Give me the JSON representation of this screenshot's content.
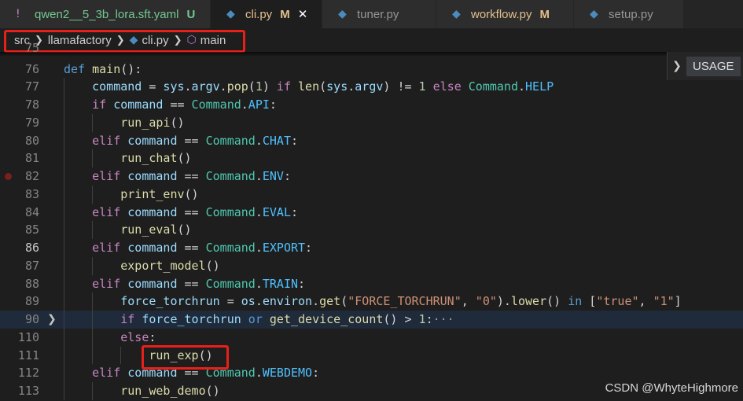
{
  "tabs": [
    {
      "label": "qwen2__5_3b_lora.sft.yaml",
      "status": "U",
      "icon": "exclamation-icon",
      "icon_glyph": "!",
      "icon_color": "#c586c0",
      "label_color": "#73c991",
      "active": false,
      "width": 268
    },
    {
      "label": "cli.py",
      "status": "M",
      "icon": "python-icon",
      "icon_glyph": "◆",
      "icon_color": "#4b8bbe",
      "label_color": "#e2c08d",
      "active": true,
      "close": "✕",
      "width": 142
    },
    {
      "label": "tuner.py",
      "icon": "python-icon",
      "icon_glyph": "◆",
      "icon_color": "#4b8bbe",
      "label_color": "#969696",
      "active": false,
      "width": 145
    },
    {
      "label": "workflow.py",
      "status": "M",
      "icon": "python-icon",
      "icon_glyph": "◆",
      "icon_color": "#4b8bbe",
      "label_color": "#e2c08d",
      "active": false,
      "width": 175
    },
    {
      "label": "setup.py",
      "icon": "python-icon",
      "icon_glyph": "◆",
      "icon_color": "#4b8bbe",
      "label_color": "#969696",
      "active": false,
      "width": 140
    }
  ],
  "breadcrumb": {
    "src": "src",
    "pkg": "llamafactory",
    "file": "cli.py",
    "symbol": "main"
  },
  "usage_label": "USAGE",
  "watermark": "CSDN @WhyteHighmore",
  "lines": [
    {
      "n": "76",
      "indent": 0,
      "tokens": [
        [
          "k",
          "def "
        ],
        [
          "f",
          "main"
        ],
        [
          "p",
          "():"
        ]
      ]
    },
    {
      "n": "77",
      "indent": 1,
      "tokens": [
        [
          "v",
          "command"
        ],
        [
          "p",
          " = "
        ],
        [
          "v",
          "sys"
        ],
        [
          "p",
          "."
        ],
        [
          "v",
          "argv"
        ],
        [
          "p",
          "."
        ],
        [
          "f",
          "pop"
        ],
        [
          "p",
          "("
        ],
        [
          "n",
          "1"
        ],
        [
          "p",
          ") "
        ],
        [
          "kc",
          "if "
        ],
        [
          "f",
          "len"
        ],
        [
          "p",
          "("
        ],
        [
          "v",
          "sys"
        ],
        [
          "p",
          "."
        ],
        [
          "v",
          "argv"
        ],
        [
          "p",
          ") != "
        ],
        [
          "n",
          "1"
        ],
        [
          "p",
          " "
        ],
        [
          "kc",
          "else "
        ],
        [
          "c",
          "Command"
        ],
        [
          "p",
          "."
        ],
        [
          "e",
          "HELP"
        ]
      ]
    },
    {
      "n": "78",
      "indent": 1,
      "tokens": [
        [
          "kc",
          "if "
        ],
        [
          "v",
          "command"
        ],
        [
          "p",
          " == "
        ],
        [
          "c",
          "Command"
        ],
        [
          "p",
          "."
        ],
        [
          "e",
          "API"
        ],
        [
          "p",
          ":"
        ]
      ]
    },
    {
      "n": "79",
      "indent": 2,
      "tokens": [
        [
          "f",
          "run_api"
        ],
        [
          "p",
          "()"
        ]
      ]
    },
    {
      "n": "80",
      "indent": 1,
      "tokens": [
        [
          "kc",
          "elif "
        ],
        [
          "v",
          "command"
        ],
        [
          "p",
          " == "
        ],
        [
          "c",
          "Command"
        ],
        [
          "p",
          "."
        ],
        [
          "e",
          "CHAT"
        ],
        [
          "p",
          ":"
        ]
      ]
    },
    {
      "n": "81",
      "indent": 2,
      "tokens": [
        [
          "f",
          "run_chat"
        ],
        [
          "p",
          "()"
        ]
      ]
    },
    {
      "n": "82",
      "indent": 1,
      "breakpoint": true,
      "tokens": [
        [
          "kc",
          "elif "
        ],
        [
          "v",
          "command"
        ],
        [
          "p",
          " == "
        ],
        [
          "c",
          "Command"
        ],
        [
          "p",
          "."
        ],
        [
          "e",
          "ENV"
        ],
        [
          "p",
          ":"
        ]
      ]
    },
    {
      "n": "83",
      "indent": 2,
      "tokens": [
        [
          "f",
          "print_env"
        ],
        [
          "p",
          "()"
        ]
      ]
    },
    {
      "n": "84",
      "indent": 1,
      "tokens": [
        [
          "kc",
          "elif "
        ],
        [
          "v",
          "command"
        ],
        [
          "p",
          " == "
        ],
        [
          "c",
          "Command"
        ],
        [
          "p",
          "."
        ],
        [
          "e",
          "EVAL"
        ],
        [
          "p",
          ":"
        ]
      ]
    },
    {
      "n": "85",
      "indent": 2,
      "tokens": [
        [
          "f",
          "run_eval"
        ],
        [
          "p",
          "()"
        ]
      ]
    },
    {
      "n": "86",
      "indent": 1,
      "current": true,
      "tokens": [
        [
          "kc",
          "elif "
        ],
        [
          "v",
          "command"
        ],
        [
          "p",
          " == "
        ],
        [
          "c",
          "Command"
        ],
        [
          "p",
          "."
        ],
        [
          "e",
          "EXPORT"
        ],
        [
          "p",
          ":"
        ]
      ]
    },
    {
      "n": "87",
      "indent": 2,
      "tokens": [
        [
          "f",
          "export_model"
        ],
        [
          "p",
          "()"
        ]
      ]
    },
    {
      "n": "88",
      "indent": 1,
      "tokens": [
        [
          "kc",
          "elif "
        ],
        [
          "v",
          "command"
        ],
        [
          "p",
          " == "
        ],
        [
          "c",
          "Command"
        ],
        [
          "p",
          "."
        ],
        [
          "e",
          "TRAIN"
        ],
        [
          "p",
          ":"
        ]
      ]
    },
    {
      "n": "89",
      "indent": 2,
      "tokens": [
        [
          "v",
          "force_torchrun"
        ],
        [
          "p",
          " = "
        ],
        [
          "v",
          "os"
        ],
        [
          "p",
          "."
        ],
        [
          "v",
          "environ"
        ],
        [
          "p",
          "."
        ],
        [
          "f",
          "get"
        ],
        [
          "p",
          "("
        ],
        [
          "s",
          "\"FORCE_TORCHRUN\""
        ],
        [
          "p",
          ", "
        ],
        [
          "s",
          "\"0\""
        ],
        [
          "p",
          ")."
        ],
        [
          "f",
          "lower"
        ],
        [
          "p",
          "() "
        ],
        [
          "k",
          "in "
        ],
        [
          "p",
          "["
        ],
        [
          "s",
          "\"true\""
        ],
        [
          "p",
          ", "
        ],
        [
          "s",
          "\"1\""
        ],
        [
          "p",
          "]"
        ]
      ]
    },
    {
      "n": "90",
      "indent": 2,
      "fold": true,
      "highlight": true,
      "tokens": [
        [
          "kc",
          "if "
        ],
        [
          "v",
          "force_torchrun"
        ],
        [
          "p",
          " "
        ],
        [
          "k",
          "or "
        ],
        [
          "f",
          "get_device_count"
        ],
        [
          "p",
          "() > "
        ],
        [
          "n",
          "1"
        ],
        [
          "p",
          ":"
        ],
        [
          "ell",
          "···"
        ]
      ]
    },
    {
      "n": "110",
      "indent": 2,
      "tokens": [
        [
          "kc",
          "else"
        ],
        [
          "p",
          ":"
        ]
      ]
    },
    {
      "n": "111",
      "indent": 3,
      "tokens": [
        [
          "f",
          "run_exp"
        ],
        [
          "p",
          "()"
        ]
      ]
    },
    {
      "n": "112",
      "indent": 1,
      "tokens": [
        [
          "kc",
          "elif "
        ],
        [
          "v",
          "command"
        ],
        [
          "p",
          " == "
        ],
        [
          "c",
          "Command"
        ],
        [
          "p",
          "."
        ],
        [
          "e",
          "WEBDEMO"
        ],
        [
          "p",
          ":"
        ]
      ]
    },
    {
      "n": "113",
      "indent": 2,
      "tokens": [
        [
          "f",
          "run_web_demo"
        ],
        [
          "p",
          "()"
        ]
      ]
    }
  ]
}
